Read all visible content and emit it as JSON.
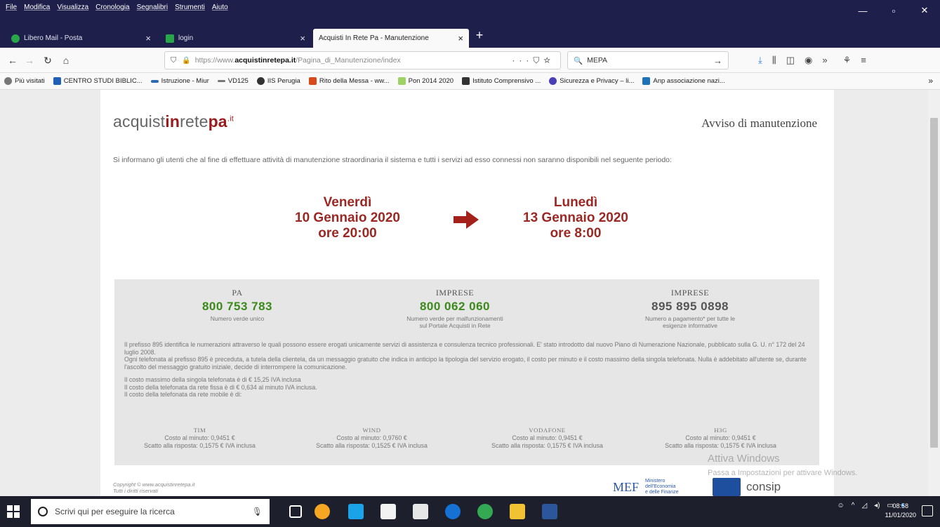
{
  "menu": [
    "File",
    "Modifica",
    "Visualizza",
    "Cronologia",
    "Segnalibri",
    "Strumenti",
    "Aiuto"
  ],
  "window_controls": [
    "—",
    "▫",
    "✕"
  ],
  "tabs": [
    {
      "label": "Libero Mail - Posta",
      "color": "#2aa64a"
    },
    {
      "label": "login",
      "color": "#2aa64a"
    },
    {
      "label": "Acquisti In Rete Pa - Manutenzione",
      "color": "#ffffff"
    }
  ],
  "url": {
    "prefix": "https://www.",
    "domain": "acquistinretepa.it",
    "path": "/Pagina_di_Manutenzione/index"
  },
  "search": {
    "value": "MEPA"
  },
  "bookmarks": [
    {
      "label": "Più visitati",
      "color": "#777777"
    },
    {
      "label": "CENTRO STUDI BIBLIC...",
      "color": "#1f5fb5"
    },
    {
      "label": "Istruzione - Miur",
      "color": "#2d6ab3"
    },
    {
      "label": "VD125",
      "color": "#777777"
    },
    {
      "label": "IIS Perugia",
      "color": "#333333"
    },
    {
      "label": "Rito della Messa - ww...",
      "color": "#d84a1b"
    },
    {
      "label": "Pon 2014 2020",
      "color": "#9ed266"
    },
    {
      "label": "Istituto Comprensivo ...",
      "color": "#333333"
    },
    {
      "label": "Sicurezza e Privacy – li...",
      "color": "#4b3fb5"
    },
    {
      "label": "Anp associazione nazi...",
      "color": "#1e73b8"
    }
  ],
  "page": {
    "logo": {
      "pre": "acquist",
      "in": "in",
      "rete": "rete",
      "pa": "pa",
      "it": ".it"
    },
    "heading": "Avviso di manutenzione",
    "intro": "Si informano gli utenti che al fine di effettuare attività di manutenzione straordinaria il sistema e tutti i servizi ad esso connessi non saranno disponibili nel seguente periodo:",
    "start": {
      "day": "Venerdì",
      "date": "10 Gennaio 2020",
      "time": "ore 20:00"
    },
    "end": {
      "day": "Lunedì",
      "date": "13 Gennaio 2020",
      "time": "ore 8:00"
    },
    "contacts": [
      {
        "title": "PA",
        "number": "800 753 783",
        "desc": "Numero verde unico"
      },
      {
        "title": "IMPRESE",
        "number": "800 062 060",
        "desc": "Numero verde per malfunzionamenti sul Portale Acquisti in Rete"
      },
      {
        "title": "IMPRESE",
        "number": "895 895 0898",
        "desc": "Numero a pagamento* per tutte le esigenze informative"
      }
    ],
    "notes": [
      "Il prefisso 895 identifica le numerazioni attraverso le quali possono essere erogati unicamente servizi di assistenza e consulenza tecnico professionali. E' stato introdotto dal nuovo Piano di Numerazione Nazionale, pubblicato sulla G. U. n° 172 del 24 luglio 2008.",
      "Ogni telefonata al prefisso 895 è preceduta, a tutela della clientela, da un messaggio gratuito che indica in anticipo la tipologia del servizio erogato, il costo per minuto e il costo massimo della singola telefonata. Nulla è addebitato all'utente se, durante l'ascolto del messaggio gratuito iniziale, decide di interrompere la comunicazione.",
      "Il costo massimo della singola telefonata è di € 15,25 IVA inclusa",
      "Il costo della telefonata da rete fissa è di € 0,634 al minuto IVA inclusa.",
      "Il costo della telefonata da rete mobile è di:"
    ],
    "operators": [
      {
        "name": "TIM",
        "cost": "Costo al minuto: 0,9451 €",
        "scatto": "Scatto alla risposta: 0,1575 € IVA inclusa"
      },
      {
        "name": "WIND",
        "cost": "Costo al minuto: 0,9760 €",
        "scatto": "Scatto alla risposta: 0,1525 € IVA inclusa"
      },
      {
        "name": "VODAFONE",
        "cost": "Costo al minuto: 0,9451 €",
        "scatto": "Scatto alla risposta: 0,1575 € IVA inclusa"
      },
      {
        "name": "H3G",
        "cost": "Costo al minuto: 0,9451 €",
        "scatto": "Scatto alla risposta: 0,1575 € IVA inclusa"
      }
    ],
    "copyright": [
      "Copyright © www.acquistinretepa.it",
      "Tutti i diritti riservati"
    ],
    "mef": "MEF",
    "mef_sub": [
      "Ministero",
      "dell'Economia",
      "e delle Finanze"
    ],
    "consip": "consip"
  },
  "activate": {
    "title": "Attiva Windows",
    "sub": "Passa a Impostazioni per attivare Windows."
  },
  "taskbar": {
    "search_placeholder": "Scrivi qui per eseguire la ricerca",
    "time": "08:58",
    "date": "11/01/2020"
  }
}
